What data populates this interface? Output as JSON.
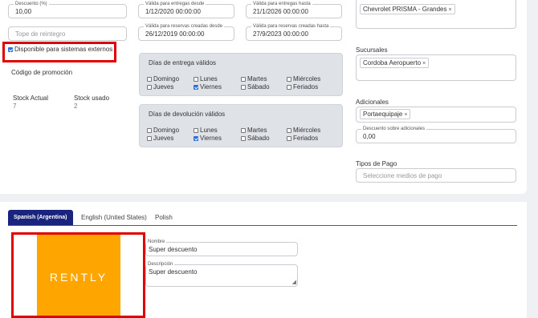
{
  "discount": {
    "label": "Descuento (%)",
    "value": "10,00"
  },
  "delivery_from": {
    "label": "Válida para entregas desde",
    "value": "1/12/2020 00:00:00"
  },
  "delivery_to": {
    "label": "Válida para entregas hasta",
    "value": "21/1/2026 00:00:00"
  },
  "reserve_from": {
    "label": "Válida para reservas creadas desde",
    "value": "26/12/2019 00:00:00"
  },
  "reserve_to": {
    "label": "Válida para reservas creadas hasta",
    "value": "27/9/2023 00:00:00"
  },
  "refund_cap": {
    "placeholder": "Tope de reintegro"
  },
  "external_systems": {
    "label": "Disponible para sistemas externos",
    "checked": true
  },
  "promo_code_label": "Código de promoción",
  "stock": {
    "actual_label": "Stock Actual",
    "actual_value": "7",
    "used_label": "Stock usado",
    "used_value": "2"
  },
  "delivery_days": {
    "title": "Días de entrega válidos",
    "days": [
      {
        "label": "Domingo",
        "checked": false
      },
      {
        "label": "Lunes",
        "checked": false
      },
      {
        "label": "Martes",
        "checked": false
      },
      {
        "label": "Miércoles",
        "checked": false
      },
      {
        "label": "Jueves",
        "checked": false
      },
      {
        "label": "Viernes",
        "checked": true
      },
      {
        "label": "Sábado",
        "checked": false
      },
      {
        "label": "Feriados",
        "checked": false
      }
    ]
  },
  "return_days": {
    "title": "Días de devolución válidos",
    "days": [
      {
        "label": "Domingo",
        "checked": false
      },
      {
        "label": "Lunes",
        "checked": false
      },
      {
        "label": "Martes",
        "checked": false
      },
      {
        "label": "Miércoles",
        "checked": false
      },
      {
        "label": "Jueves",
        "checked": false
      },
      {
        "label": "Viernes",
        "checked": true
      },
      {
        "label": "Sábado",
        "checked": false
      },
      {
        "label": "Feriados",
        "checked": false
      }
    ]
  },
  "models": {
    "tag": "Chevrolet PRISMA - Grandes",
    "remove": "×"
  },
  "branches": {
    "label": "Sucursales",
    "tag": "Cordoba Aeropuerto",
    "remove": "×"
  },
  "additionals": {
    "label": "Adicionales",
    "tag": "Portaequipaje",
    "remove": "×"
  },
  "additionals_discount": {
    "label": "Descuento sobre adicionales",
    "value": "0,00"
  },
  "payment_types": {
    "label": "Tipos de Pago",
    "placeholder": "Seleccione medios de pago"
  },
  "tabs": [
    {
      "label": "Spanish (Argentina)",
      "active": true
    },
    {
      "label": "English (United States)",
      "active": false
    },
    {
      "label": "Polish",
      "active": false
    }
  ],
  "logo": {
    "text": "RENTLY",
    "color": "#ffa500"
  },
  "name_field": {
    "label": "Nombre",
    "value": "Super descuento"
  },
  "description_field": {
    "label": "Descripción",
    "value": "Super descuento"
  },
  "colors": {
    "accent": "#1a237e",
    "highlight": "#e00000",
    "checkbox": "#2a6fdb"
  }
}
